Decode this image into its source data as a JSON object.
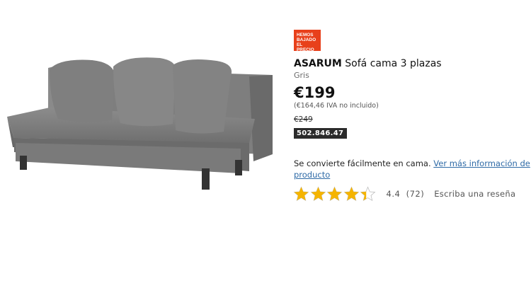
{
  "product": {
    "badge_text": "HEMOS\nBAJADO\nEL PRECIO",
    "name": "ASARUM",
    "type": "Sofá cama 3 plazas",
    "color": "Gris",
    "price": "€199",
    "price_without_vat": "(€164,46 IVA no incluido)",
    "old_price": "€249",
    "article_number": "502.846.47",
    "description": "Se convierte fácilmente en cama.",
    "more_info_link": "Ver más información de producto",
    "rating": 4.4,
    "rating_display": "4.4",
    "review_count": "(72)",
    "write_review_link": "Escriba una reseña",
    "image_icon": "sofa-image"
  },
  "colors": {
    "badge": "#e8401b",
    "star": "#f5b400",
    "link": "#2e6aa6",
    "article_bg": "#2b2b2b"
  }
}
